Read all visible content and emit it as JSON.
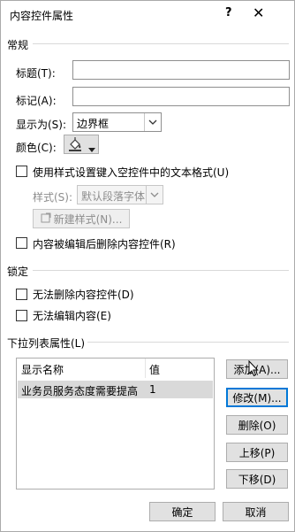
{
  "window": {
    "title": "内容控件属性",
    "help_label": "?",
    "close_label": "✕"
  },
  "general": {
    "section_label": "常规",
    "title_label": "标题(T):",
    "title_value": "",
    "tag_label": "标记(A):",
    "tag_value": "",
    "show_as_label": "显示为(S):",
    "show_as_value": "边界框",
    "color_label": "颜色(C):",
    "use_style_label": "使用样式设置键入空控件中的文本格式(U)",
    "use_style_checked": false,
    "style_label": "样式(S):",
    "style_value": "默认段落字体",
    "new_style_button": "新建样式(N)...",
    "remove_on_edit_label": "内容被编辑后删除内容控件(R)",
    "remove_on_edit_checked": false
  },
  "locking": {
    "section_label": "锁定",
    "cannot_delete_label": "无法删除内容控件(D)",
    "cannot_delete_checked": false,
    "cannot_edit_label": "无法编辑内容(E)",
    "cannot_edit_checked": false
  },
  "dropdown": {
    "section_label": "下拉列表属性(L)",
    "columns": [
      "显示名称",
      "值"
    ],
    "rows": [
      {
        "display_name": "业务员服务态度需要提高",
        "value": "1"
      }
    ],
    "add_button": "添加(A)...",
    "modify_button": "修改(M)...",
    "delete_button": "删除(O)",
    "move_up_button": "上移(P)",
    "move_down_button": "下移(D)"
  },
  "footer": {
    "ok_button": "确定",
    "cancel_button": "取消"
  },
  "colors": {
    "accent": "#0078d7",
    "fill_icon": "#3c3c3c"
  },
  "icons": {
    "paint_bucket": "paint-bucket-icon",
    "chevron_down": "chevron-down-icon",
    "cursor": "mouse-cursor-icon"
  }
}
